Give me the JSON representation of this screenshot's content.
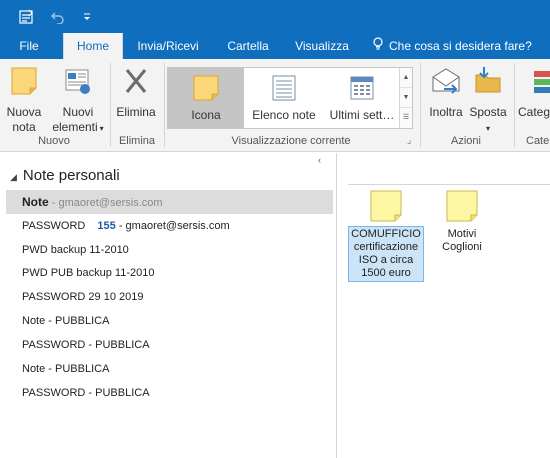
{
  "quick_access": {
    "sendrecv_icon": "send-receive-all-icon",
    "undo_icon": "undo-icon",
    "customize_icon": "customize-qat-icon"
  },
  "tabs": [
    {
      "label": "File"
    },
    {
      "label": "Home"
    },
    {
      "label": "Invia/Ricevi"
    },
    {
      "label": "Cartella"
    },
    {
      "label": "Visualizza"
    },
    {
      "label": "Che cosa si desidera fare?"
    }
  ],
  "ribbon": {
    "nuovo": {
      "nuova_nota": {
        "line1": "Nuova",
        "line2": "nota"
      },
      "nuovi_elementi": {
        "line1": "Nuovi",
        "line2": "elementi"
      },
      "group": "Nuovo"
    },
    "elimina": {
      "button": "Elimina",
      "group": "Elimina"
    },
    "visualizzazione": {
      "items": [
        "Icona",
        "Elenco note",
        "Ultimi sett…"
      ],
      "selected": "Icona",
      "group": "Visualizzazione corrente"
    },
    "azioni": {
      "inoltra": "Inoltra",
      "sposta": "Sposta",
      "group": "Azioni"
    },
    "categorie": {
      "label": "Categ",
      "group": "Cate"
    }
  },
  "nav": {
    "title": "Note personali",
    "items": [
      {
        "name": "Note",
        "suffix": " - gmaoret@sersis.com",
        "selected": true
      },
      {
        "name": "PASSWORD",
        "count": "155",
        "suffix": " - gmaoret@sersis.com"
      },
      {
        "name": "PWD backup 11-2010"
      },
      {
        "name": "PWD PUB backup 11-2010"
      },
      {
        "name": "PASSWORD 29 10 2019"
      },
      {
        "name": "Note - PUBBLICA"
      },
      {
        "name": "PASSWORD - PUBBLICA"
      },
      {
        "name": "Note - PUBBLICA"
      },
      {
        "name": "PASSWORD - PUBBLICA"
      }
    ]
  },
  "notes": [
    {
      "lines": [
        "COMUFFICIO",
        "certificazione",
        "ISO a circa",
        "1500 euro"
      ],
      "selected": true
    },
    {
      "lines": [
        "Motivi",
        "Coglioni"
      ],
      "selected": false
    }
  ],
  "colors": {
    "accent": "#106ebe",
    "sticky": "#fdf7a1",
    "sticky_border": "#c9b84a",
    "selected_nav": "#dcdcdc"
  }
}
